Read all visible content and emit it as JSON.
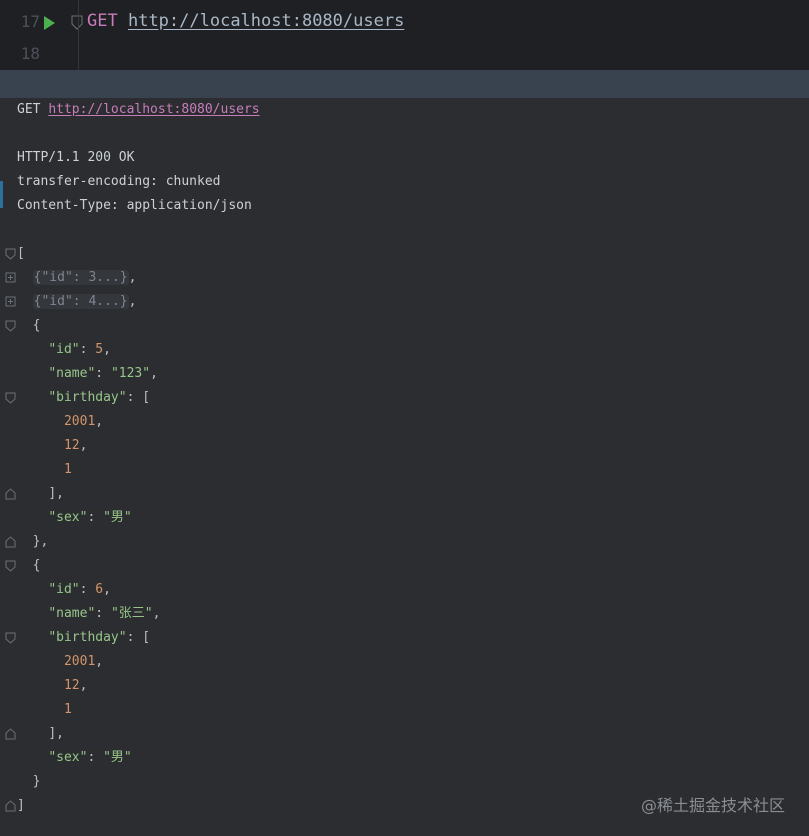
{
  "editor": {
    "line_numbers": [
      "17",
      "18"
    ],
    "method": "GET",
    "url": "http://localhost:8080/users"
  },
  "response": {
    "request_method": "GET",
    "request_url": "http://localhost:8080/users",
    "status_line": "HTTP/1.1 200 OK",
    "headers": [
      "transfer-encoding: chunked",
      "Content-Type: application/json"
    ],
    "body": {
      "collapsed": [
        "{\"id\": 3...}",
        "{\"id\": 4...}"
      ],
      "items": [
        {
          "id": "5",
          "name": "\"123\"",
          "birthday": [
            "2001",
            "12",
            "1"
          ],
          "sex": "\"男\""
        },
        {
          "id": "6",
          "name": "\"张三\"",
          "birthday": [
            "2001",
            "12",
            "1"
          ],
          "sex": "\"男\""
        }
      ]
    }
  },
  "watermark": "@稀土掘金技术社区",
  "colors": {
    "editor_bg": "#1f2023",
    "response_bg": "#2b2d30",
    "header_bar": "#39434f",
    "method_purple": "#c77dbb",
    "string_green": "#98c58a",
    "number_orange": "#d3946b",
    "run_green": "#4caf50"
  },
  "icons": [
    "run-icon",
    "fold-icon",
    "expand-icon"
  ]
}
